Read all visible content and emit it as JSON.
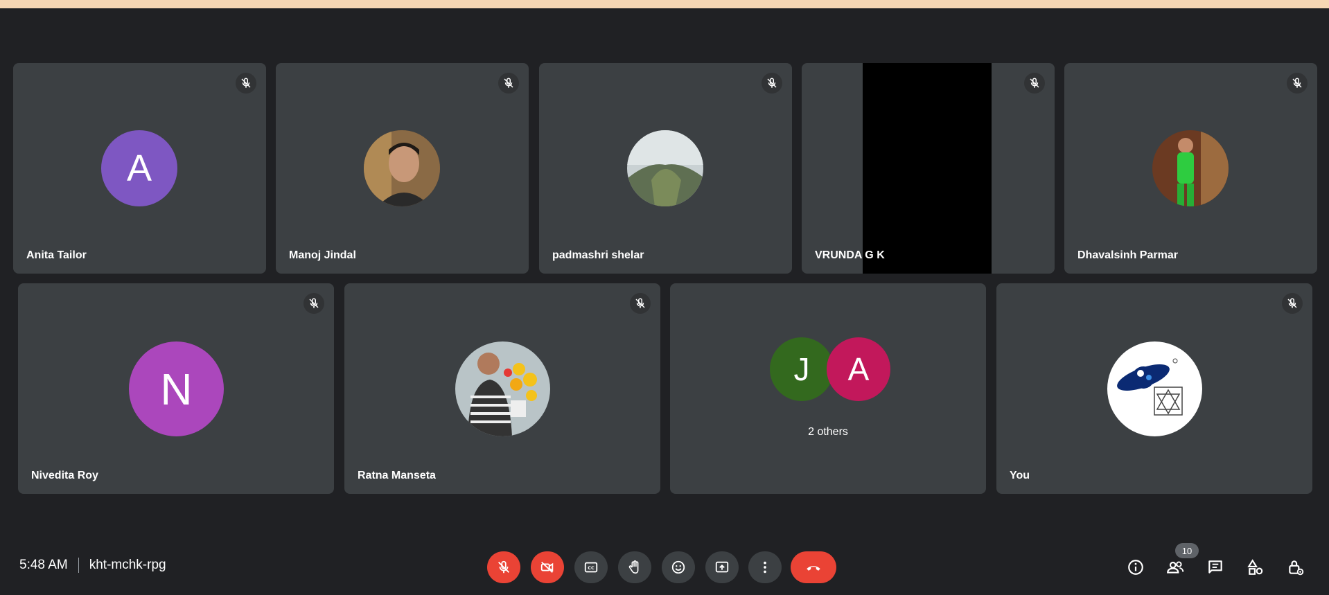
{
  "participants": [
    {
      "name": "Anita Tailor",
      "initial": "A",
      "avatar_color": "#7e57c2"
    },
    {
      "name": "Manoj Jindal",
      "avatar": "photo-man"
    },
    {
      "name": "padmashri shelar",
      "avatar": "photo-landscape"
    },
    {
      "name": "VRUNDA G K",
      "avatar": "video-black"
    },
    {
      "name": "Dhavalsinh Parmar",
      "avatar": "photo-child"
    },
    {
      "name": "Nivedita Roy",
      "initial": "N",
      "avatar_color": "#ab47bc"
    },
    {
      "name": "Ratna Manseta",
      "avatar": "photo-woman-flowers"
    },
    {
      "name": "You",
      "avatar": "logo"
    }
  ],
  "others": {
    "label": "2 others",
    "initials": [
      "J",
      "A"
    ],
    "colors": [
      "#33691e",
      "#c2185b"
    ]
  },
  "meeting": {
    "time": "5:48 AM",
    "code": "kht-mchk-rpg"
  },
  "people_count": "10",
  "colors": {
    "background": "#202124",
    "tile": "#3c4043",
    "danger": "#ea4335",
    "top_strip": "#f6d7b4"
  },
  "controls": [
    {
      "name": "mic-off-icon",
      "state": "off"
    },
    {
      "name": "camera-off-icon",
      "state": "off"
    },
    {
      "name": "captions-icon"
    },
    {
      "name": "raise-hand-icon"
    },
    {
      "name": "emoji-icon"
    },
    {
      "name": "present-icon"
    },
    {
      "name": "more-options-icon"
    },
    {
      "name": "end-call-icon"
    }
  ],
  "right_controls": [
    {
      "name": "info-icon"
    },
    {
      "name": "people-icon"
    },
    {
      "name": "chat-icon"
    },
    {
      "name": "activities-icon"
    },
    {
      "name": "host-controls-icon"
    }
  ]
}
